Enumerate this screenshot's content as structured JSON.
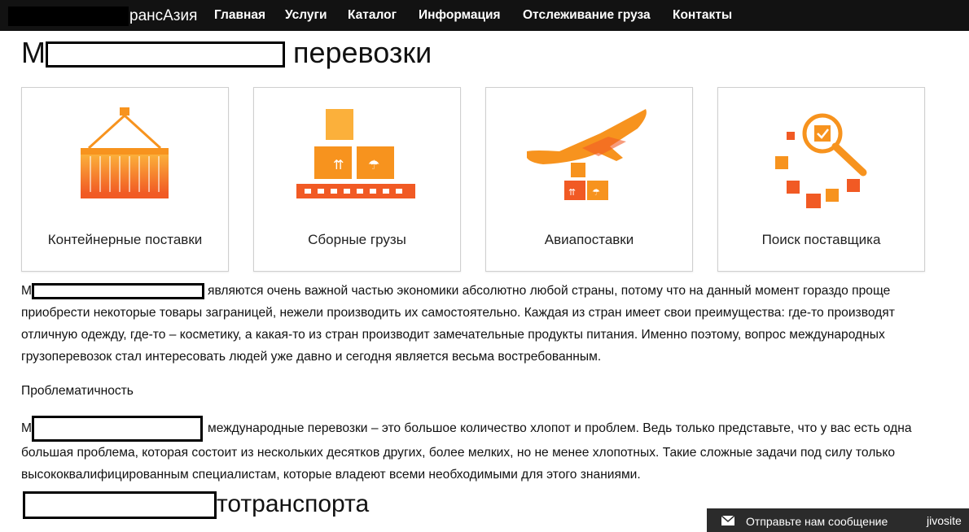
{
  "nav": {
    "brand_suffix": "рансАзия",
    "items": [
      "Главная",
      "Услуги",
      "Каталог",
      "Информация",
      "Отслеживание груза",
      "Контакты"
    ]
  },
  "page": {
    "title_prefix": "М",
    "title_suffix": "перевозки"
  },
  "cards": [
    {
      "label": "Контейнерные поставки",
      "icon": "container-icon"
    },
    {
      "label": "Сборные грузы",
      "icon": "boxes-icon"
    },
    {
      "label": "Авиапоставки",
      "icon": "airplane-icon"
    },
    {
      "label": "Поиск поставщика",
      "icon": "magnifier-icon"
    }
  ],
  "content": {
    "para1_start": "М",
    "para1": "являются очень важной частью экономики абсолютно любой страны, потому что на данный момент гораздо проще приобрести некоторые товары заграницей, нежели производить их самостоятельно. Каждая из стран имеет свои преимущества: где-то производят отличную одежду, где-то – косметику, а какая-то из стран производит замечательные продукты питания. Именно поэтому, вопрос международных грузоперевозок стал интересовать людей уже давно и сегодня является весьма востребованным.",
    "subheading": "Проблематичность",
    "para2_start": "М",
    "para2": "международные перевозки – это большое количество хлопот и проблем. Ведь только представьте, что у вас есть одна большая проблема, которая состоит из нескольких десятков других, более мелких, но не менее хлопотных. Такие сложные задачи под силу только высококвалифицированным специалистам, которые владеют всеми необходимыми для этого знаниями.",
    "heading2_suffix": "тотранспорта"
  },
  "chat": {
    "label": "Отправьте нам сообщение",
    "brand": "jivosite"
  },
  "colors": {
    "navbar": "#121212",
    "icon_orange": "#f7931e",
    "icon_dark_orange": "#f15a24"
  }
}
